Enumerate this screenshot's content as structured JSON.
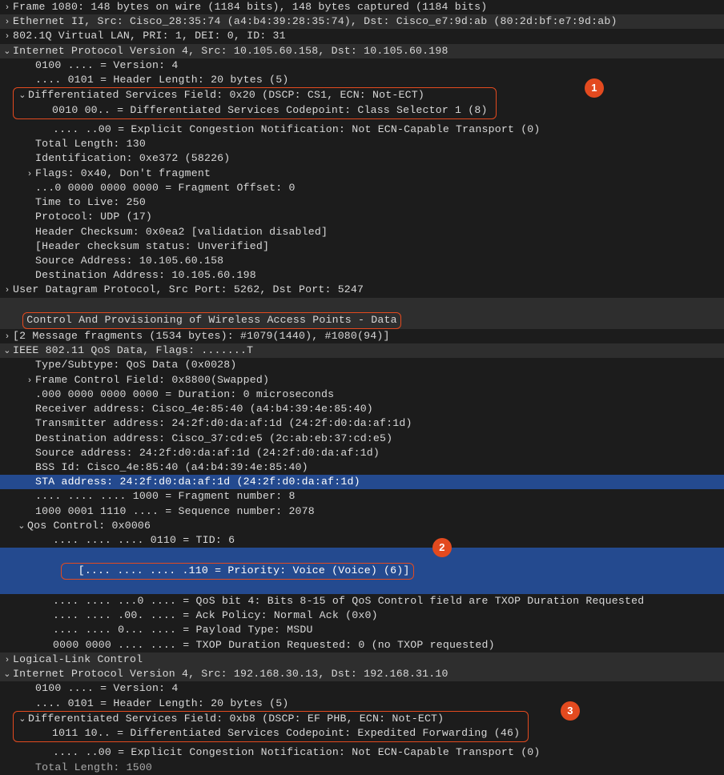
{
  "lines": {
    "l1": "Frame 1080: 148 bytes on wire (1184 bits), 148 bytes captured (1184 bits)",
    "l2": "Ethernet II, Src: Cisco_28:35:74 (a4:b4:39:28:35:74), Dst: Cisco_e7:9d:ab (80:2d:bf:e7:9d:ab)",
    "l3": "802.1Q Virtual LAN, PRI: 1, DEI: 0, ID: 31",
    "l4": "Internet Protocol Version 4, Src: 10.105.60.158, Dst: 10.105.60.198",
    "l5": "0100 .... = Version: 4",
    "l6": ".... 0101 = Header Length: 20 bytes (5)",
    "l7": "Differentiated Services Field: 0x20 (DSCP: CS1, ECN: Not-ECT)",
    "l8": "0010 00.. = Differentiated Services Codepoint: Class Selector 1 (8)",
    "l9": ".... ..00 = Explicit Congestion Notification: Not ECN-Capable Transport (0)",
    "l10": "Total Length: 130",
    "l11": "Identification: 0xe372 (58226)",
    "l12": "Flags: 0x40, Don't fragment",
    "l13": "...0 0000 0000 0000 = Fragment Offset: 0",
    "l14": "Time to Live: 250",
    "l15": "Protocol: UDP (17)",
    "l16": "Header Checksum: 0x0ea2 [validation disabled]",
    "l17": "[Header checksum status: Unverified]",
    "l18": "Source Address: 10.105.60.158",
    "l19": "Destination Address: 10.105.60.198",
    "l20": "User Datagram Protocol, Src Port: 5262, Dst Port: 5247",
    "l21": "Control And Provisioning of Wireless Access Points - Data",
    "l22": "[2 Message fragments (1534 bytes): #1079(1440), #1080(94)]",
    "l23": "IEEE 802.11 QoS Data, Flags: .......T",
    "l24": "Type/Subtype: QoS Data (0x0028)",
    "l25": "Frame Control Field: 0x8800(Swapped)",
    "l26": ".000 0000 0000 0000 = Duration: 0 microseconds",
    "l27": "Receiver address: Cisco_4e:85:40 (a4:b4:39:4e:85:40)",
    "l28": "Transmitter address: 24:2f:d0:da:af:1d (24:2f:d0:da:af:1d)",
    "l29": "Destination address: Cisco_37:cd:e5 (2c:ab:eb:37:cd:e5)",
    "l30": "Source address: 24:2f:d0:da:af:1d (24:2f:d0:da:af:1d)",
    "l31": "BSS Id: Cisco_4e:85:40 (a4:b4:39:4e:85:40)",
    "l32": "STA address: 24:2f:d0:da:af:1d (24:2f:d0:da:af:1d)",
    "l33": ".... .... .... 1000 = Fragment number: 8",
    "l34": "1000 0001 1110 .... = Sequence number: 2078",
    "l35": "Qos Control: 0x0006",
    "l36": ".... .... .... 0110 = TID: 6",
    "l37": "[.... .... .... .110 = Priority: Voice (Voice) (6)]",
    "l38": ".... .... ...0 .... = QoS bit 4: Bits 8-15 of QoS Control field are TXOP Duration Requested",
    "l39": ".... .... .00. .... = Ack Policy: Normal Ack (0x0)",
    "l40": ".... .... 0... .... = Payload Type: MSDU",
    "l41": "0000 0000 .... .... = TXOP Duration Requested: 0 (no TXOP requested)",
    "l42": "Logical-Link Control",
    "l43": "Internet Protocol Version 4, Src: 192.168.30.13, Dst: 192.168.31.10",
    "l44": "0100 .... = Version: 4",
    "l45": ".... 0101 = Header Length: 20 bytes (5)",
    "l46": "Differentiated Services Field: 0xb8 (DSCP: EF PHB, ECN: Not-ECT)",
    "l47": "1011 10.. = Differentiated Services Codepoint: Expedited Forwarding (46)",
    "l48": ".... ..00 = Explicit Congestion Notification: Not ECN-Capable Transport (0)",
    "l49": "Total Length: 1500"
  },
  "callouts": {
    "c1": "1",
    "c2": "2",
    "c3": "3"
  }
}
